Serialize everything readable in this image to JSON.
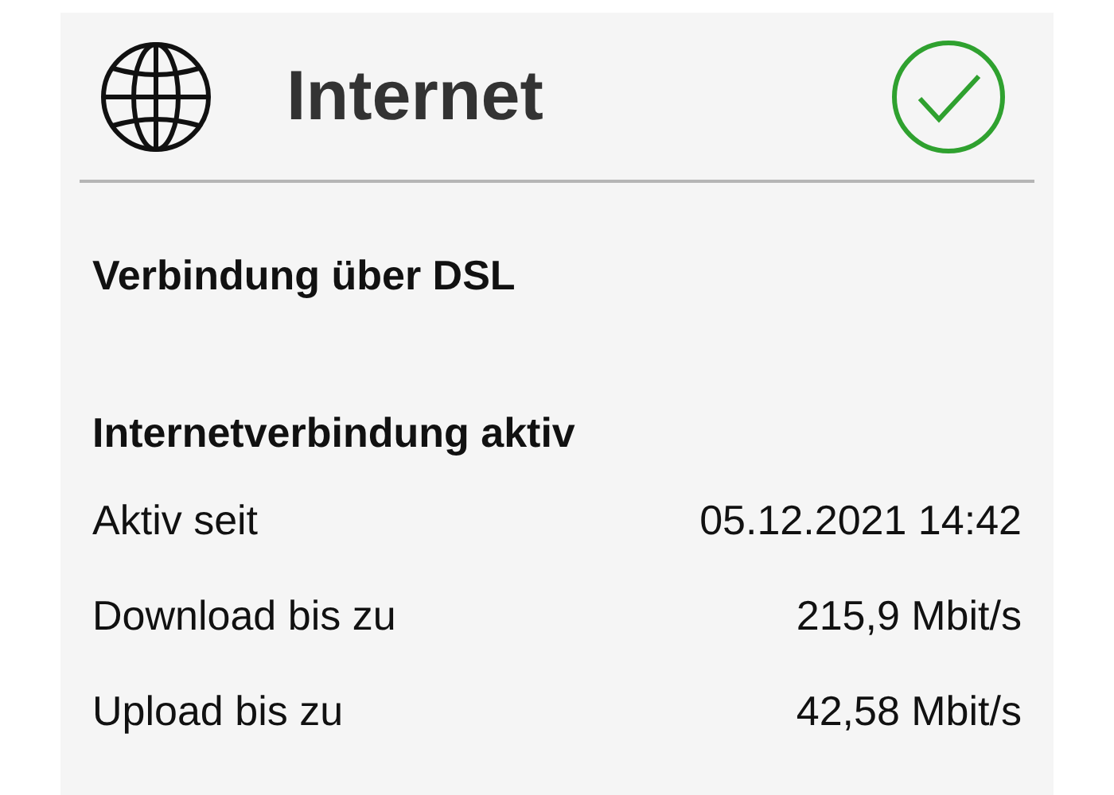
{
  "header": {
    "title": "Internet",
    "connected": true
  },
  "connection_type": "Verbindung über DSL",
  "status": "Internetverbindung aktiv",
  "rows": [
    {
      "label": "Aktiv seit",
      "value": "05.12.2021 14:42"
    },
    {
      "label": "Download bis zu",
      "value": "215,9 Mbit/s"
    },
    {
      "label": "Upload bis zu",
      "value": "42,58 Mbit/s"
    }
  ]
}
